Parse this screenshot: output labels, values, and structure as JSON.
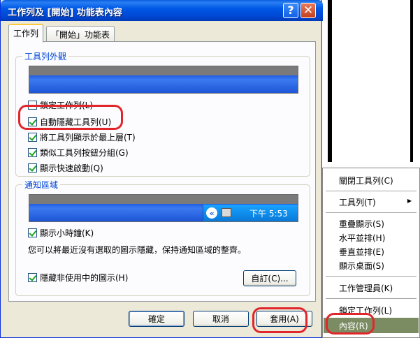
{
  "dialog": {
    "title": "工作列及 [開始] 功能表內容",
    "help_glyph": "?",
    "close_glyph": "✕",
    "tabs": [
      {
        "label": "工作列"
      },
      {
        "label": "「開始」功能表"
      }
    ],
    "taskbar_group": {
      "legend": "工具列外觀",
      "options": [
        {
          "label": "鎖定工作列(L)",
          "checked": false
        },
        {
          "label": "自動隱藏工具列(U)",
          "checked": true
        },
        {
          "label": "將工具列顯示於最上層(T)",
          "checked": true
        },
        {
          "label": "類似工具列按鈕分組(G)",
          "checked": true
        },
        {
          "label": "顯示快速啟動(Q)",
          "checked": true
        }
      ]
    },
    "notification_group": {
      "legend": "通知區域",
      "tray_chevron": "«",
      "tray_clock": "下午 5:53",
      "show_clock": {
        "label": "顯示小時鐘(K)",
        "checked": true
      },
      "description": "您可以將最近沒有選取的圖示隱藏，保持通知區域的整齊。",
      "hide_inactive": {
        "label": "隱藏非使用中的圖示(H)",
        "checked": true
      },
      "customize_button": "自訂(C)..."
    },
    "buttons": {
      "ok": "確定",
      "cancel": "取消",
      "apply": "套用(A)"
    }
  },
  "context_menu": {
    "items": [
      {
        "label": "關閉工具列(C)",
        "submenu": false
      },
      {
        "label": "工具列(T)",
        "submenu": true
      },
      {
        "label": "重疊顯示(S)",
        "submenu": false
      },
      {
        "label": "水平並排(H)",
        "submenu": false
      },
      {
        "label": "垂直並排(E)",
        "submenu": false
      },
      {
        "label": "顯示桌面(S)",
        "submenu": false
      },
      {
        "label": "工作管理員(K)",
        "submenu": false
      },
      {
        "label": "鎖定工作列(L)",
        "submenu": false
      },
      {
        "label": "內容(R)",
        "submenu": false,
        "selected": true
      }
    ],
    "submenu_arrow": "▶"
  },
  "colors": {
    "titlebar": "#0058e6",
    "highlight": "#e0262a",
    "menu_selected": "#7b8c63",
    "legend_text": "#0046d5"
  }
}
